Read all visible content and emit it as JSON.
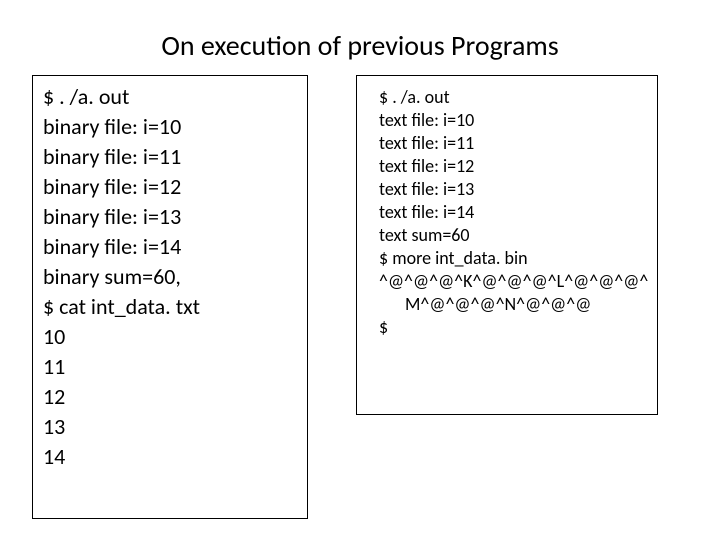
{
  "title": "On execution of previous Programs",
  "left": {
    "lines": [
      "$ . /a. out",
      "binary file: i=10",
      "binary file: i=11",
      "binary file: i=12",
      "binary file: i=13",
      "binary file: i=14",
      "binary sum=60,",
      "$ cat int_data. txt",
      "10",
      "11",
      "12",
      "13",
      "14"
    ]
  },
  "right": {
    "lines": [
      "$ . /a. out",
      "text file: i=10",
      "text file: i=11",
      "text file: i=12",
      "text file: i=13",
      "text file: i=14",
      "text sum=60",
      "$ more int_data. bin",
      "^@^@^@^K^@^@^@^L^@^@^@^"
    ],
    "indent_line": "M^@^@^@^N^@^@^@",
    "tail": "$"
  }
}
